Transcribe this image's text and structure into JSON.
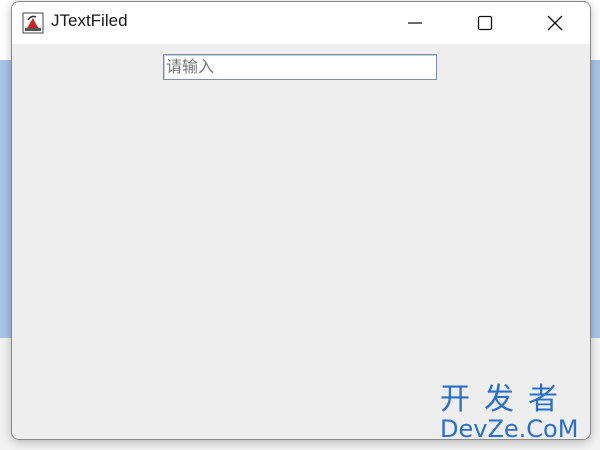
{
  "window": {
    "title": "JTextFiled",
    "controls": {
      "minimize_icon": "minimize-icon",
      "maximize_icon": "maximize-icon",
      "close_icon": "close-icon"
    }
  },
  "text_field": {
    "placeholder": "请输入"
  },
  "watermark": {
    "cn": "开发者",
    "en": "DevZe.CoM"
  },
  "colors": {
    "window_bg": "#eeeeee",
    "titlebar_bg": "#ffffff",
    "watermark": "#2a6fc9"
  }
}
